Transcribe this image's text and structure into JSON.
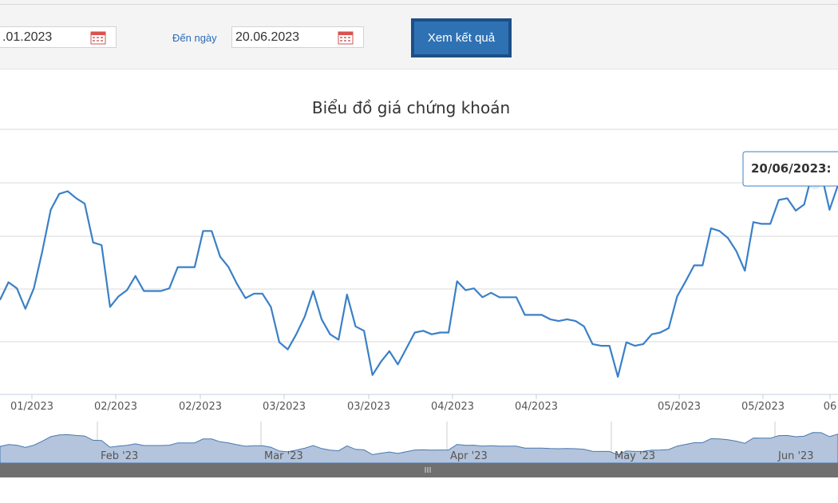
{
  "form": {
    "from_date": ".01.2023",
    "to_label": "Đến ngày",
    "to_date": "20.06.2023",
    "submit_label": "Xem kết quả"
  },
  "tooltip": {
    "text": "20/06/2023:"
  },
  "colors": {
    "line": "#3a80c8",
    "navigator_fill": "#b3c4dc",
    "button": "#2f72b4"
  },
  "chart_data": {
    "type": "line",
    "title": "Biểu đồ giá chứng khoán",
    "xlabel": "",
    "ylabel": "",
    "grid": true,
    "x_tick_labels": [
      "01/2023",
      "02/2023",
      "02/2023",
      "03/2023",
      "03/2023",
      "04/2023",
      "04/2023",
      "05/2023",
      "05/2023",
      "06"
    ],
    "navigator_labels": [
      "Feb '23",
      "Mar '23",
      "Apr '23",
      "May '23",
      "Jun '23"
    ],
    "series": [
      {
        "values": [
          59.5,
          61.5,
          60.8,
          58.5,
          60.8,
          65.0,
          69.7,
          71.5,
          71.8,
          71.0,
          70.4,
          66.0,
          65.7,
          58.7,
          59.9,
          60.6,
          62.2,
          60.5,
          60.5,
          60.5,
          60.8,
          63.2,
          63.2,
          63.2,
          67.3,
          67.3,
          64.4,
          63.2,
          61.3,
          59.7,
          60.2,
          60.2,
          58.7,
          54.7,
          53.9,
          55.6,
          57.6,
          60.5,
          57.3,
          55.6,
          55.0,
          60.1,
          56.5,
          56.0,
          51.0,
          52.5,
          53.7,
          52.2,
          54.0,
          55.8,
          56.0,
          55.6,
          55.8,
          55.8,
          61.6,
          60.6,
          60.8,
          59.8,
          60.3,
          59.8,
          59.8,
          59.8,
          57.8,
          57.8,
          57.8,
          57.3,
          57.1,
          57.3,
          57.1,
          56.5,
          54.5,
          54.3,
          54.3,
          50.8,
          54.7,
          54.3,
          54.5,
          55.6,
          55.8,
          56.3,
          59.9,
          61.6,
          63.4,
          63.4,
          67.6,
          67.3,
          66.5,
          65.0,
          62.8,
          68.3,
          68.1,
          68.1,
          70.8,
          71.0,
          69.6,
          70.3,
          74.0,
          73.9,
          69.7,
          72.5
        ]
      }
    ]
  }
}
